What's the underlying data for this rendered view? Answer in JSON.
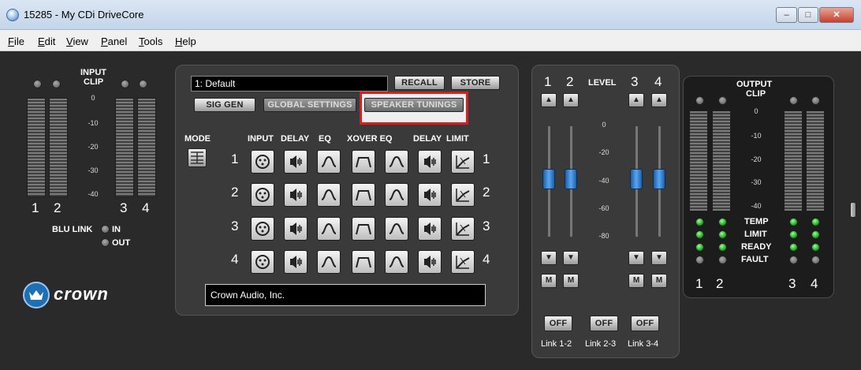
{
  "window": {
    "title": "15285 - My CDi DriveCore",
    "minimize": "–",
    "maximize": "□",
    "close": "✕"
  },
  "menu": [
    "File",
    "Edit",
    "View",
    "Panel",
    "Tools",
    "Help"
  ],
  "input": {
    "title": "INPUT",
    "clip": "CLIP",
    "scale": [
      "0",
      "-10",
      "-20",
      "-30",
      "-40"
    ],
    "channels": [
      "1",
      "2",
      "3",
      "4"
    ],
    "blu_link": "BLU LINK",
    "in": "IN",
    "out": "OUT"
  },
  "preset": {
    "value": "1: Default",
    "recall": "RECALL",
    "store": "STORE",
    "sig_gen": "SIG GEN",
    "global_settings": "GLOBAL SETTINGS",
    "speaker_tunings": "SPEAKER TUNINGS"
  },
  "signal_chain": {
    "mode": "MODE",
    "headers": [
      "INPUT",
      "DELAY",
      "EQ",
      "XOVER EQ",
      "DELAY",
      "LIMIT"
    ],
    "rows": [
      "1",
      "2",
      "3",
      "4"
    ]
  },
  "company": "Crown Audio, Inc.",
  "brand": "crown",
  "level": {
    "label": "LEVEL",
    "channels": [
      "1",
      "2",
      "3",
      "4"
    ],
    "scale": [
      "0",
      "-20",
      "-40",
      "-60",
      "-80"
    ],
    "up": "▲",
    "down": "▼",
    "mute": "M",
    "links": [
      {
        "state": "OFF",
        "label": "Link 1-2"
      },
      {
        "state": "OFF",
        "label": "Link 2-3"
      },
      {
        "state": "OFF",
        "label": "Link 3-4"
      }
    ]
  },
  "output": {
    "title": "OUTPUT",
    "clip": "CLIP",
    "scale": [
      "0",
      "-10",
      "-20",
      "-30",
      "-40"
    ],
    "status": [
      "TEMP",
      "LIMIT",
      "READY",
      "FAULT"
    ],
    "channels": [
      "1",
      "2",
      "3",
      "4"
    ]
  }
}
